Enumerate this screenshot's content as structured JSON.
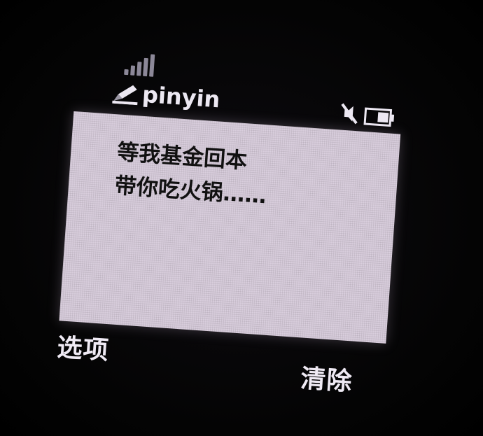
{
  "status_bar": {
    "input_mode": "pinyin",
    "icons": {
      "signal": "signal-strength-icon",
      "pen": "pen-icon",
      "mute": "mute-icon",
      "battery": "battery-icon"
    }
  },
  "message": {
    "lines": [
      "等我基金回本",
      "带你吃火锅……"
    ]
  },
  "softkeys": {
    "left_label": "选项",
    "right_label": "清除"
  },
  "colors": {
    "screen_bg": "#d9cedd",
    "text": "#111111",
    "softkey_text": "#efeaf4",
    "background": "#050505"
  }
}
